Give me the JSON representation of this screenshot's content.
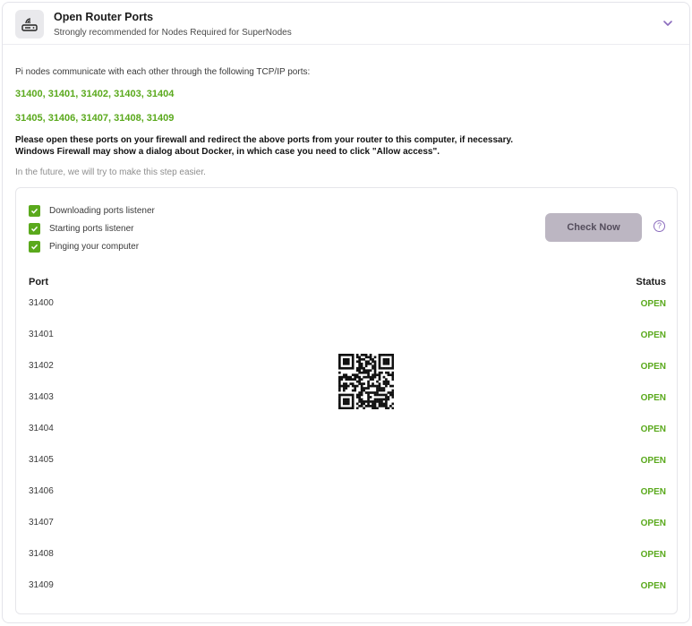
{
  "header": {
    "icon": "router-icon",
    "title": "Open Router Ports",
    "subtitle": "Strongly recommended for Nodes Required for SuperNodes",
    "chevron_icon": "chevron-down-icon",
    "accent": "#8a6bbd"
  },
  "intro": "Pi nodes communicate with each other through the following TCP/IP ports:",
  "port_lines": [
    "31400, 31401, 31402, 31403, 31404",
    "31405, 31406, 31407, 31408, 31409"
  ],
  "instructions": [
    "Please open these ports on your firewall and redirect the above ports from your router to this computer, if necessary.",
    "Windows Firewall may show a dialog about Docker, in which case you need to click \"Allow access\"."
  ],
  "future_note": "In the future, we will try to make this step easier.",
  "checklist": [
    {
      "label": "Downloading ports listener",
      "done": true
    },
    {
      "label": "Starting ports listener",
      "done": true
    },
    {
      "label": "Pinging your computer",
      "done": true
    }
  ],
  "check_now_label": "Check Now",
  "help_icon": "help-circle-icon",
  "table": {
    "headers": {
      "port": "Port",
      "status": "Status"
    },
    "rows": [
      {
        "port": "31400",
        "status": "OPEN"
      },
      {
        "port": "31401",
        "status": "OPEN"
      },
      {
        "port": "31402",
        "status": "OPEN"
      },
      {
        "port": "31403",
        "status": "OPEN"
      },
      {
        "port": "31404",
        "status": "OPEN"
      },
      {
        "port": "31405",
        "status": "OPEN"
      },
      {
        "port": "31406",
        "status": "OPEN"
      },
      {
        "port": "31407",
        "status": "OPEN"
      },
      {
        "port": "31408",
        "status": "OPEN"
      },
      {
        "port": "31409",
        "status": "OPEN"
      }
    ]
  },
  "colors": {
    "open_green": "#5aa91c",
    "button_bg": "#bcb6c2"
  }
}
